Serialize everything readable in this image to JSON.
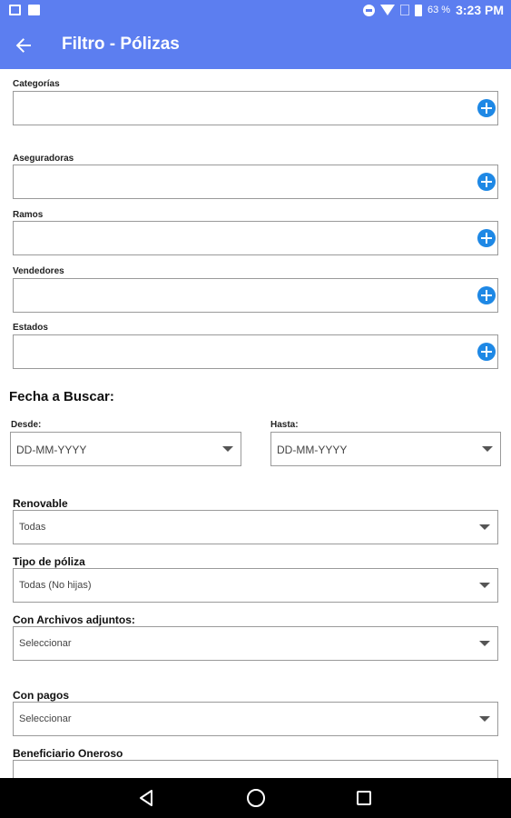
{
  "status_bar": {
    "battery_percent": "63 %",
    "time": "3:23 PM"
  },
  "app_bar": {
    "back_icon": "arrow-left-icon",
    "title": "Filtro - Pólizas"
  },
  "pickers": [
    {
      "label": "Categorías",
      "icon": "add-circle-icon"
    },
    {
      "label": "Aseguradoras",
      "icon": "add-circle-icon"
    },
    {
      "label": "Ramos",
      "icon": "add-circle-icon"
    },
    {
      "label": "Vendedores",
      "icon": "add-circle-icon"
    },
    {
      "label": "Estados",
      "icon": "add-circle-icon"
    }
  ],
  "date_section": {
    "title": "Fecha a Buscar:",
    "from": {
      "label": "Desde:",
      "value": "DD-MM-YYYY"
    },
    "to": {
      "label": "Hasta:",
      "value": "DD-MM-YYYY"
    }
  },
  "selects": [
    {
      "label": "Renovable",
      "value": "Todas"
    },
    {
      "label": "Tipo de póliza",
      "value": "Todas (No hijas)"
    },
    {
      "label": "Con Archivos adjuntos:",
      "value": "Seleccionar"
    },
    {
      "label": "Con pagos",
      "value": "Seleccionar"
    },
    {
      "label": "Beneficiario Oneroso",
      "value": ""
    }
  ],
  "nav_bar": {
    "back_icon": "triangle-back-icon",
    "home_icon": "circle-home-icon",
    "recent_icon": "square-recents-icon"
  },
  "colors": {
    "primary": "#5c7ef0",
    "accent": "#1e88e5"
  }
}
